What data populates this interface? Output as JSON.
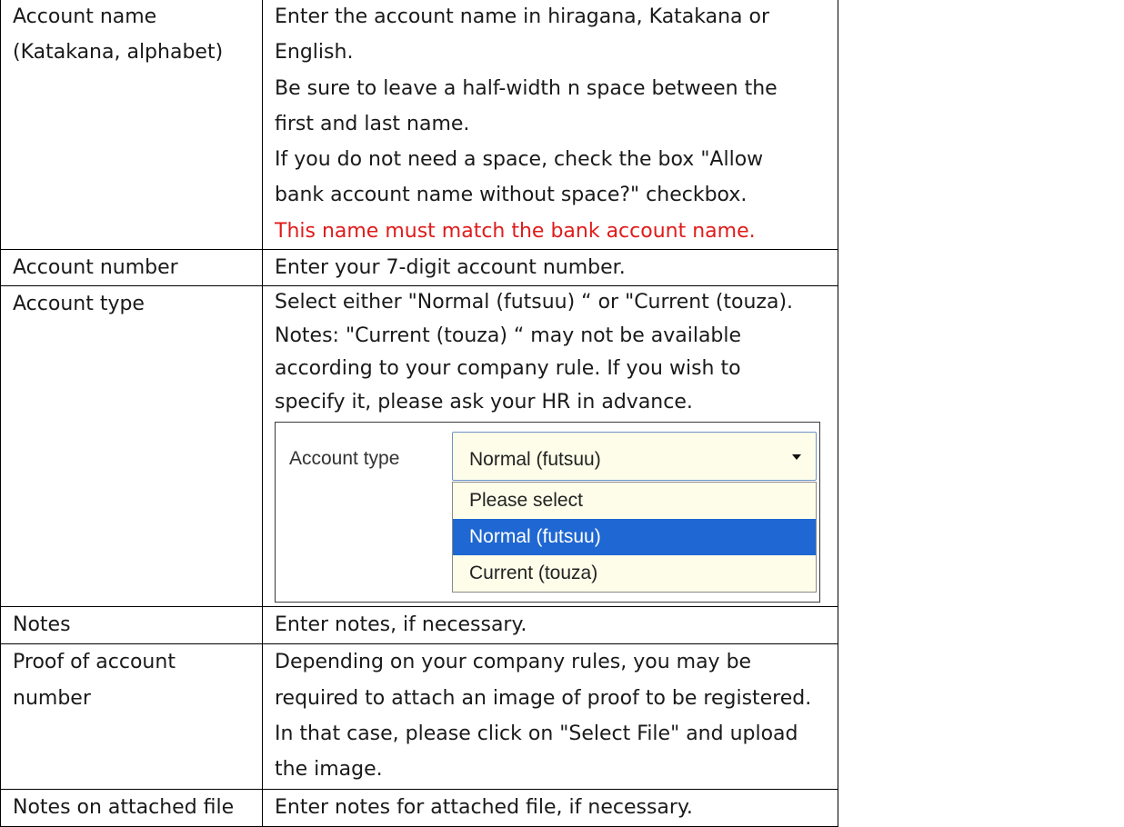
{
  "rows": [
    {
      "label": [
        "Account name",
        "(Katakana, alphabet)"
      ],
      "lines": [
        "Enter the account name in hiragana, Katakana or",
        "English.",
        "Be sure to leave a half-width n space between the",
        "first and last name.",
        "If you do not need a space, check the box \"Allow",
        "bank account name without space?\" checkbox."
      ],
      "note_red": "This name must match the bank account name."
    },
    {
      "label": [
        "Account number"
      ],
      "lines": [
        "Enter your 7-digit account number."
      ]
    },
    {
      "label": [
        "Account type"
      ],
      "lines": [
        "Select either \"Normal (futsuu) “ or \"Current (touza).",
        "Notes: \"Current (touza) “ may not be available",
        "according to your company rule. If you wish to",
        "specify it, please ask your HR in advance."
      ],
      "dropdown": {
        "label": "Account type",
        "selected_value": "Normal (futsuu)",
        "options": [
          "Please select",
          "Normal (futsuu)",
          "Current (touza)"
        ],
        "highlighted_index": 1,
        "caret_icon": "caret-down-icon"
      }
    },
    {
      "label": [
        "Notes"
      ],
      "lines": [
        "Enter notes, if necessary."
      ]
    },
    {
      "label": [
        "Proof of account",
        "number"
      ],
      "lines": [
        "Depending on your company rules, you may be",
        "required to attach an image of proof to be registered.",
        "In that case, please click on \"Select File\" and upload",
        "the image."
      ]
    },
    {
      "label": [
        "Notes on attached file"
      ],
      "lines": [
        "Enter notes for attached file, if necessary."
      ]
    }
  ],
  "colors": {
    "note_red": "#e01b1b",
    "dropdown_background": "#fdfde9",
    "dropdown_highlight": "#1f67d2",
    "table_border": "#000000"
  }
}
